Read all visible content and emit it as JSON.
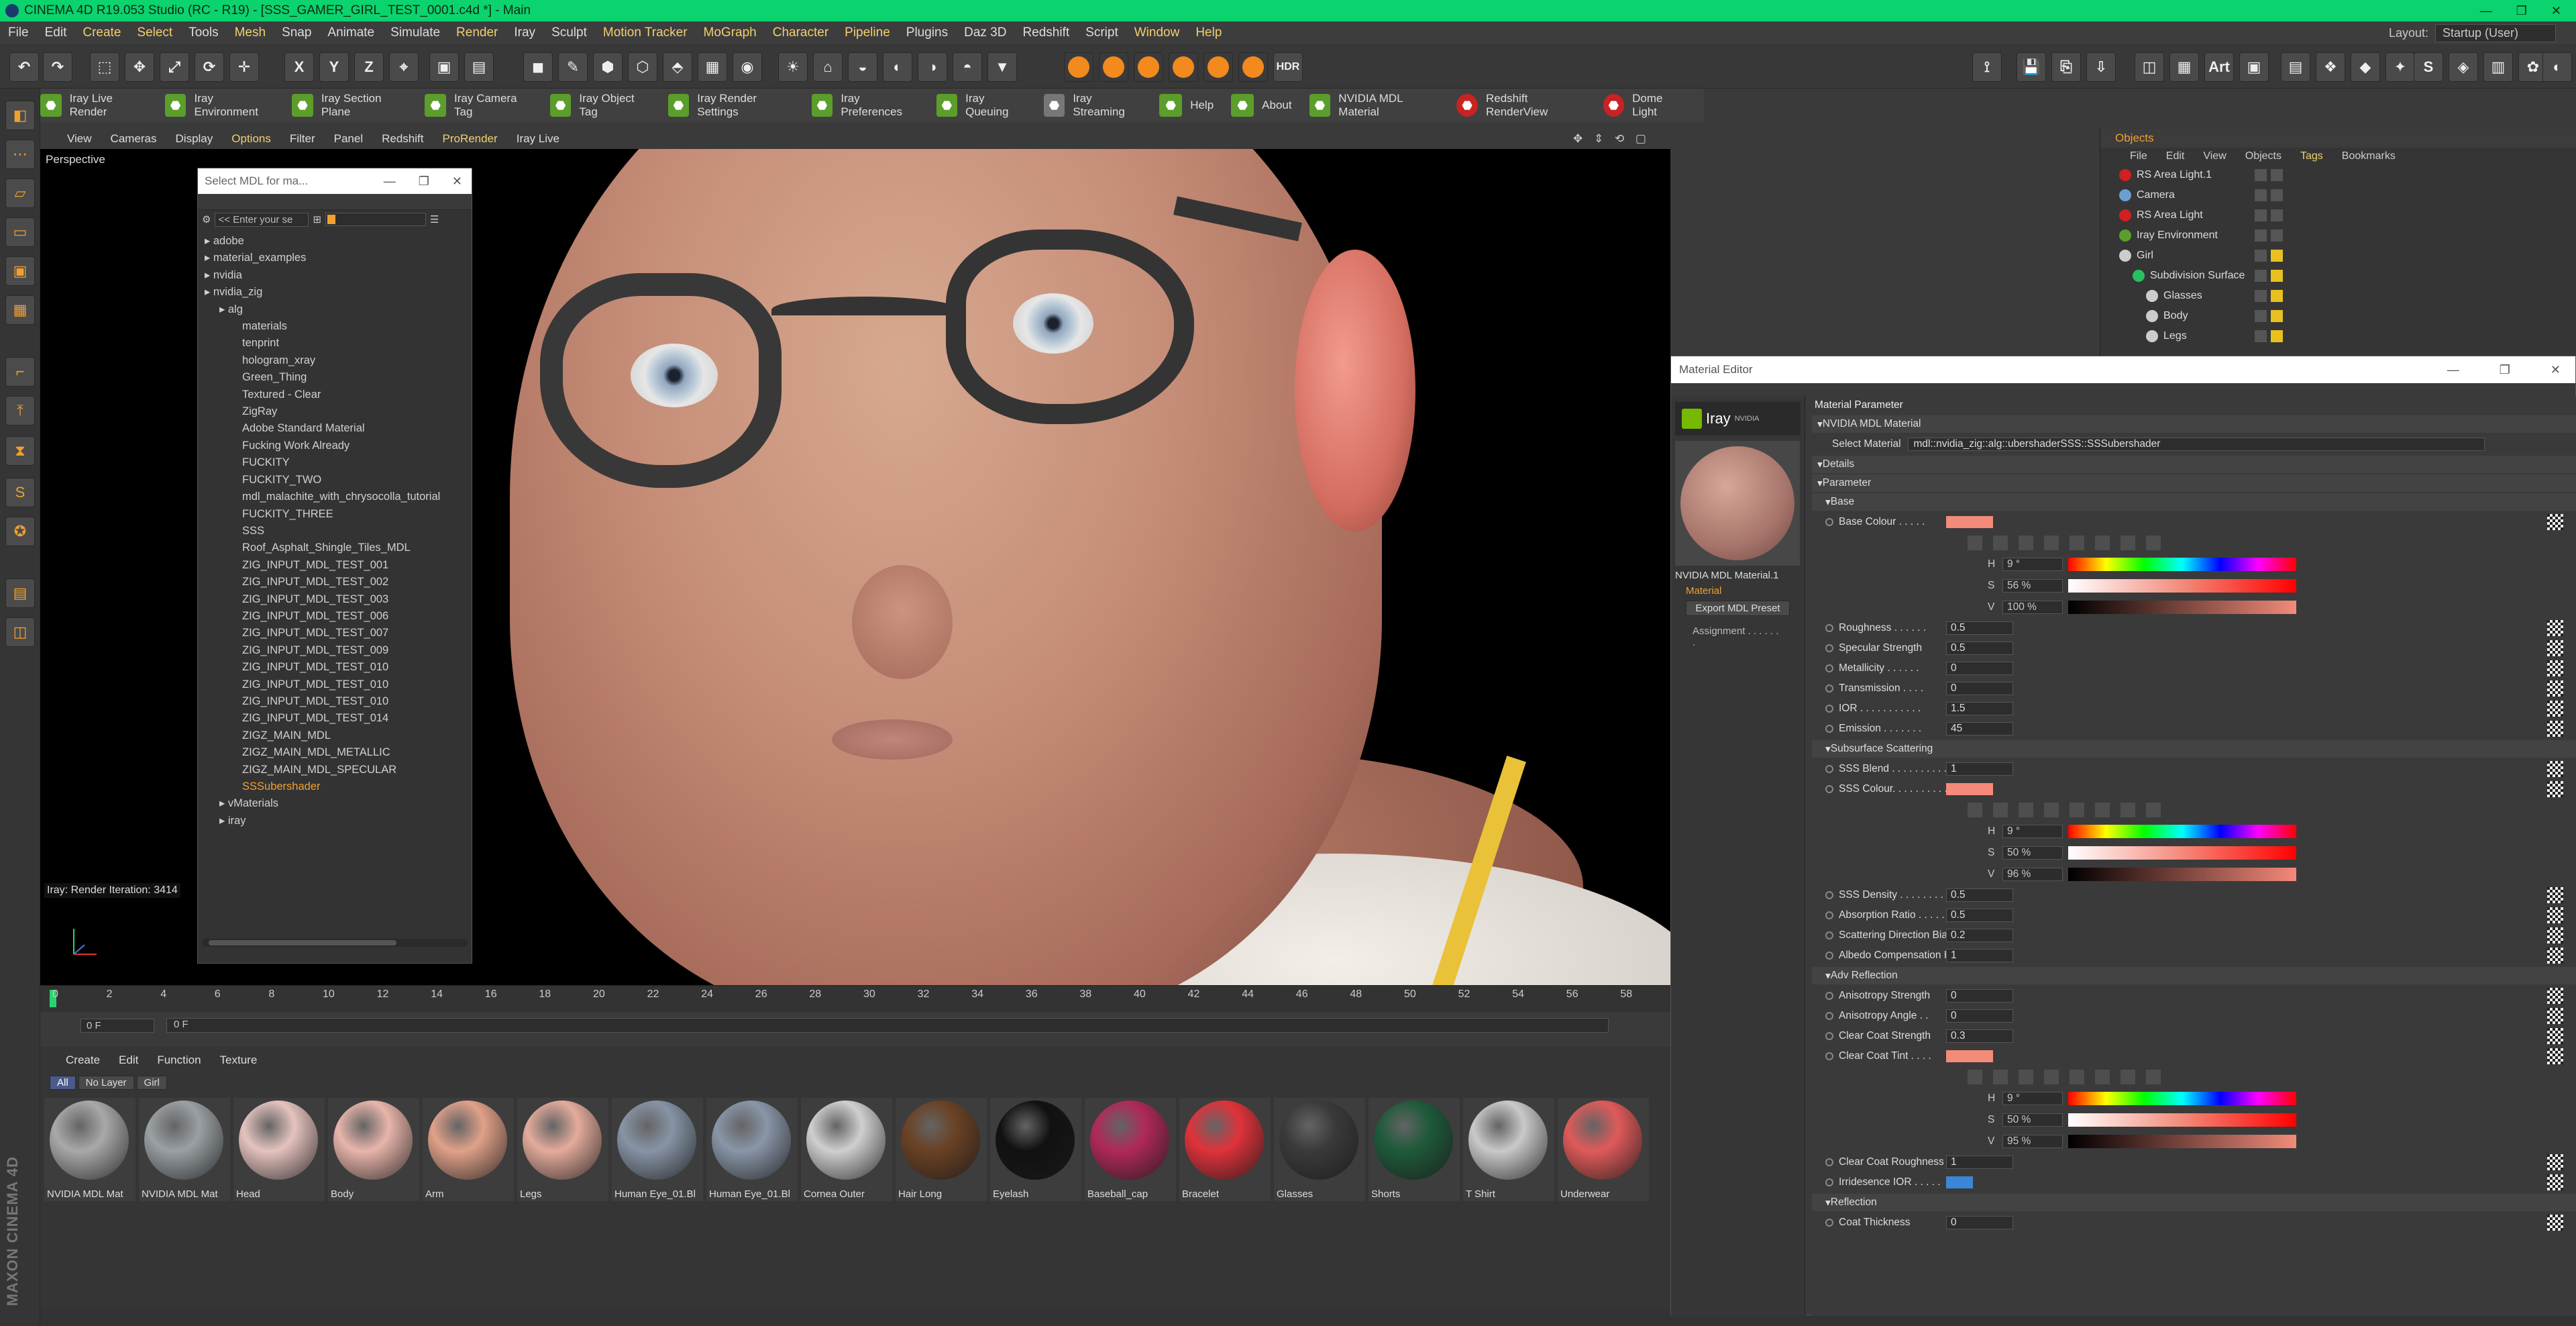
{
  "window": {
    "title": "CINEMA 4D R19.053 Studio (RC - R19) - [SSS_GAMER_GIRL_TEST_0001.c4d *] - Main",
    "controls": [
      "—",
      "❐",
      "✕"
    ]
  },
  "menubar": {
    "items": [
      "File",
      "Edit",
      "Create",
      "Select",
      "Tools",
      "Mesh",
      "Snap",
      "Animate",
      "Simulate",
      "Render",
      "Iray",
      "Sculpt",
      "Motion Tracker",
      "MoGraph",
      "Character",
      "Pipeline",
      "Plugins",
      "Daz 3D",
      "Redshift",
      "Script",
      "Window",
      "Help"
    ],
    "highlighted": [
      "Create",
      "Select",
      "Mesh",
      "Render",
      "Motion Tracker",
      "MoGraph",
      "Character",
      "Pipeline",
      "Window",
      "Help"
    ],
    "layout_label": "Layout:",
    "layout_value": "Startup (User)"
  },
  "toolbar1": {
    "axis_buttons": [
      "X",
      "Y",
      "Z"
    ],
    "hdr": "HDR",
    "art": "Art"
  },
  "iray_toolbar": {
    "items": [
      "Iray Live Render",
      "Iray Environment",
      "Iray Section Plane",
      "Iray Camera Tag",
      "Iray Object Tag",
      "Iray Render Settings",
      "Iray Preferences",
      "Iray Queuing",
      "Iray Streaming",
      "Help",
      "About",
      "NVIDIA MDL Material",
      "Redshift RenderView",
      "Dome Light"
    ]
  },
  "viewport_menu": {
    "items": [
      "View",
      "Cameras",
      "Display",
      "Options",
      "Filter",
      "Panel",
      "Redshift",
      "ProRender",
      "Iray Live"
    ],
    "highlighted": [
      "Options",
      "ProRender"
    ],
    "label": "Perspective",
    "status": "Iray: Render Iteration: 3414"
  },
  "mdl_window": {
    "title": "Select MDL for ma...",
    "search_placeholder": "<< Enter your se",
    "tree": [
      "adobe",
      "material_examples",
      "nvidia",
      "nvidia_zig",
      "alg",
      "materials",
      "tenprint",
      "hologram_xray",
      "Green_Thing",
      "Textured - Clear",
      "ZigRay",
      "Adobe Standard Material",
      "Fucking Work Already",
      "FUCKITY",
      "FUCKITY_TWO",
      "mdl_malachite_with_chrysocolla_tutorial",
      "FUCKITY_THREE",
      "SSS",
      "Roof_Asphalt_Shingle_Tiles_MDL",
      "ZIG_INPUT_MDL_TEST_001",
      "ZIG_INPUT_MDL_TEST_002",
      "ZIG_INPUT_MDL_TEST_003",
      "ZIG_INPUT_MDL_TEST_006",
      "ZIG_INPUT_MDL_TEST_007",
      "ZIG_INPUT_MDL_TEST_009",
      "ZIG_INPUT_MDL_TEST_010",
      "ZIG_INPUT_MDL_TEST_010",
      "ZIG_INPUT_MDL_TEST_010",
      "ZIG_INPUT_MDL_TEST_014",
      "ZIGZ_MAIN_MDL",
      "ZIGZ_MAIN_MDL_METALLIC",
      "ZIGZ_MAIN_MDL_SPECULAR",
      "SSSubershader",
      "vMaterials",
      "iray"
    ],
    "indent": [
      0,
      0,
      0,
      0,
      1,
      2,
      2,
      2,
      2,
      2,
      2,
      2,
      2,
      2,
      2,
      2,
      2,
      2,
      2,
      2,
      2,
      2,
      2,
      2,
      2,
      2,
      2,
      2,
      2,
      2,
      2,
      2,
      2,
      1,
      1
    ],
    "selected": "SSSubershader"
  },
  "timeline": {
    "ticks": [
      "0",
      "2",
      "4",
      "6",
      "8",
      "10",
      "12",
      "14",
      "16",
      "18",
      "20",
      "22",
      "24",
      "26",
      "28",
      "30",
      "32",
      "34",
      "36",
      "38",
      "40",
      "42",
      "44",
      "46",
      "48",
      "50",
      "52",
      "54",
      "56",
      "58"
    ],
    "frame_start": "0 F",
    "frame_end": "0 F"
  },
  "material_manager": {
    "menu": [
      "Create",
      "Edit",
      "Function",
      "Texture"
    ],
    "filters": [
      "All",
      "No Layer",
      "Girl"
    ],
    "materials": [
      {
        "name": "NVIDIA MDL Mat",
        "color": "#a9a9a9"
      },
      {
        "name": "NVIDIA MDL Mat",
        "color": "#9aa0a4"
      },
      {
        "name": "Head",
        "color": "#e5c3bf"
      },
      {
        "name": "Body",
        "color": "#e8b5ab"
      },
      {
        "name": "Arm",
        "color": "#e0a189"
      },
      {
        "name": "Legs",
        "color": "#e4ab9c"
      },
      {
        "name": "Human Eye_01.Bl",
        "color": "#8794a6"
      },
      {
        "name": "Human Eye_01.Bl",
        "color": "#8996a8"
      },
      {
        "name": "Cornea Outer",
        "color": "#cfcfcf"
      },
      {
        "name": "Hair Long",
        "color": "#6a4124"
      },
      {
        "name": "Eyelash",
        "color": "#111111"
      },
      {
        "name": "Baseball_cap",
        "color": "#b0285a"
      },
      {
        "name": "Bracelet",
        "color": "#e0323a"
      },
      {
        "name": "Glasses",
        "color": "#3a3a3a"
      },
      {
        "name": "Shorts",
        "color": "#1e5a3a"
      },
      {
        "name": "T Shirt",
        "color": "#c9c9c9"
      },
      {
        "name": "Underwear",
        "color": "#e05a5a"
      }
    ]
  },
  "objects": {
    "header": "Objects",
    "menu": [
      "File",
      "Edit",
      "View",
      "Objects",
      "Tags",
      "Bookmarks"
    ],
    "highlighted": "Tags",
    "rows": [
      {
        "name": "RS Area Light.1",
        "color": "#d02020",
        "indent": 0
      },
      {
        "name": "Camera",
        "color": "#6aa0d0",
        "indent": 0
      },
      {
        "name": "RS Area Light",
        "color": "#d02020",
        "indent": 0
      },
      {
        "name": "Iray Environment",
        "color": "#5b9e2b",
        "indent": 0
      },
      {
        "name": "Girl",
        "color": "#cccccc",
        "indent": 0
      },
      {
        "name": "Subdivision Surface",
        "color": "#2ac060",
        "indent": 1
      },
      {
        "name": "Glasses",
        "color": "#cccccc",
        "indent": 2
      },
      {
        "name": "Body",
        "color": "#cccccc",
        "indent": 2
      },
      {
        "name": "Legs",
        "color": "#cccccc",
        "indent": 2
      }
    ]
  },
  "material_editor": {
    "title": "Material Editor",
    "iray_label": "Iray",
    "nvidia_label": "NVIDIA",
    "material_name": "NVIDIA MDL Material.1",
    "material_btn": "Material",
    "export_btn": "Export MDL Preset",
    "assignment": "Assignment . . . . . . .",
    "header": "Material Parameter",
    "section_main": "NVIDIA MDL Material",
    "select_material_label": "Select Material",
    "select_material_value": "mdl::nvidia_zig::alg::ubershaderSSS::SSSubershader",
    "details": "Details",
    "parameter": "Parameter",
    "base": {
      "title": "Base",
      "colour_label": "Base Colour . . . . .",
      "colour": "#f28b7a",
      "h": "9 °",
      "s": "56 %",
      "v": "100 %",
      "params": [
        [
          "Roughness . . . . . .",
          "0.5"
        ],
        [
          "Specular Strength",
          "0.5"
        ],
        [
          "Metallicity . . . . . .",
          "0"
        ],
        [
          "Transmission . . . .",
          "0"
        ],
        [
          "IOR . . . . . . . . . . .",
          "1.5"
        ],
        [
          "Emission . . . . . . .",
          "45"
        ]
      ]
    },
    "sss": {
      "title": "Subsurface Scattering",
      "blend_label": "SSS Blend . . . . . . . . . .",
      "blend": "1",
      "colour_label": "SSS Colour. . . . . . . . . .",
      "colour": "#f5897a",
      "h": "9 °",
      "s": "50 %",
      "v": "96 %",
      "params": [
        [
          "SSS Density . . . . . . . . .",
          "0.5"
        ],
        [
          "Absorption Ratio . . . . . .",
          "0.5"
        ],
        [
          "Scattering Direction Bias",
          "0.2"
        ],
        [
          "Albedo Compensation Hack",
          "1"
        ]
      ]
    },
    "adv": {
      "title": "Adv Reflection",
      "params": [
        [
          "Anisotropy Strength",
          "0"
        ],
        [
          "Anisotropy Angle . .",
          "0"
        ],
        [
          "Clear Coat Strength",
          "0.3"
        ]
      ],
      "tint_label": "Clear Coat Tint . . . .",
      "tint": "#f28b7a",
      "h": "9 °",
      "s": "50 %",
      "v": "95 %",
      "roughness_label": "Clear Coat Roughness",
      "roughness": "1",
      "iri_label": "Irridesence IOR . . . . .",
      "iri_color": "#3a86d8"
    },
    "reflection": {
      "title": "Reflection",
      "coat_label": "Coat Thickness",
      "coat": "0"
    }
  },
  "maxon": "MAXON CINEMA 4D"
}
